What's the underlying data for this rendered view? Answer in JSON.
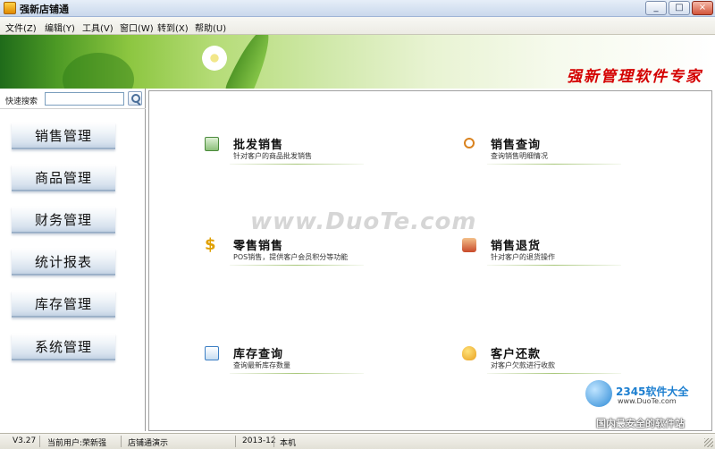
{
  "window": {
    "title": "强新店铺通",
    "buttons": [
      "_",
      "□",
      "×"
    ]
  },
  "menubar": {
    "items": [
      {
        "label": "文件(Z)"
      },
      {
        "label": "编辑(Y)"
      },
      {
        "label": "工具(V)"
      },
      {
        "label": "窗口(W)"
      },
      {
        "label": "转到(X)"
      },
      {
        "label": "帮助(U)"
      }
    ]
  },
  "banner": {
    "slogan": "强新管理软件专家"
  },
  "sidebar": {
    "search": {
      "label": "快速搜索",
      "value": ""
    },
    "items": [
      {
        "label": "销售管理"
      },
      {
        "label": "商品管理"
      },
      {
        "label": "财务管理"
      },
      {
        "label": "统计报表"
      },
      {
        "label": "库存管理"
      },
      {
        "label": "系统管理"
      }
    ]
  },
  "main": {
    "watermark": "www.DuoTe.com",
    "functions": [
      {
        "title": "批发销售",
        "desc": "针对客户的商品批发销售",
        "icon": "wholesale-icon",
        "color": "#4a8a3a"
      },
      {
        "title": "销售查询",
        "desc": "查询销售明细情况",
        "icon": "sales-query-icon",
        "color": "#d9821e"
      },
      {
        "title": "零售销售",
        "desc": "POS销售，提供客户会员积分等功能",
        "icon": "retail-icon",
        "color": "#e0a000"
      },
      {
        "title": "销售退货",
        "desc": "针对客户的退货操作",
        "icon": "return-icon",
        "color": "#c84a2a"
      },
      {
        "title": "库存查询",
        "desc": "查询最新库存数量",
        "icon": "stock-query-icon",
        "color": "#3c7fc4"
      },
      {
        "title": "客户还款",
        "desc": "对客户欠款进行收款",
        "icon": "repayment-icon",
        "color": "#e8a020"
      }
    ]
  },
  "corner_logo": {
    "brand": "2345软件大全",
    "url": "www.DuoTe.com",
    "slogan": "国内最安全的软件站"
  },
  "statusbar": {
    "version": "V3.27",
    "current_user": "当前用户:荣新强",
    "store": "店铺通演示",
    "period": "2013-12",
    "location": "本机"
  }
}
